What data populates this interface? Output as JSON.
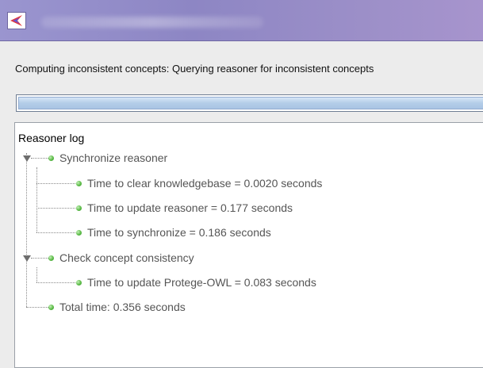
{
  "window": {
    "app_icon": "protege-logo-icon"
  },
  "status": {
    "text": "Computing inconsistent concepts: Querying reasoner for inconsistent concepts"
  },
  "progress": {
    "value": 1.0
  },
  "log": {
    "title": "Reasoner log",
    "groups": [
      {
        "label": "Synchronize reasoner",
        "children": [
          "Time to clear knowledgebase = 0.0020 seconds",
          "Time to update reasoner = 0.177 seconds",
          "Time to synchronize = 0.186 seconds"
        ]
      },
      {
        "label": "Check concept consistency",
        "children": [
          "Time to update Protege-OWL = 0.083 seconds"
        ]
      }
    ],
    "total": "Total time: 0.356 seconds"
  },
  "colors": {
    "titlebar": "#9a95cf",
    "node_dot": "#5cbb48",
    "progress_fill": "#b4cde8"
  }
}
